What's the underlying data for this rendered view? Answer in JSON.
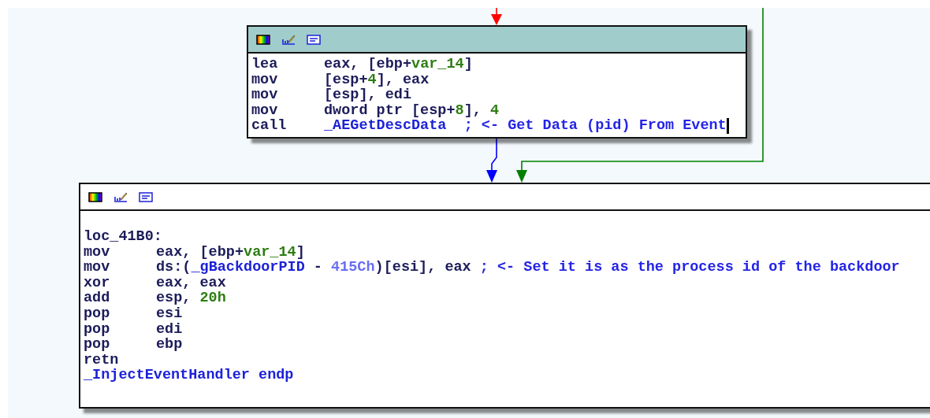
{
  "nodes": [
    {
      "selected": true,
      "lines": [
        {
          "kind": "instr",
          "cursor": false,
          "mnemonic": "lea",
          "operands": [
            {
              "kind": "text",
              "text": "eax, [ebp+"
            },
            {
              "kind": "var",
              "text": "var_14"
            },
            {
              "kind": "text",
              "text": "]"
            }
          ]
        },
        {
          "kind": "instr",
          "cursor": false,
          "mnemonic": "mov",
          "operands": [
            {
              "kind": "text",
              "text": "[esp+"
            },
            {
              "kind": "var",
              "text": "4"
            },
            {
              "kind": "text",
              "text": "], eax"
            }
          ]
        },
        {
          "kind": "instr",
          "cursor": false,
          "mnemonic": "mov",
          "operands": [
            {
              "kind": "text",
              "text": "[esp], edi"
            }
          ]
        },
        {
          "kind": "instr",
          "cursor": false,
          "mnemonic": "mov",
          "operands": [
            {
              "kind": "text",
              "text": "dword ptr [esp+"
            },
            {
              "kind": "var",
              "text": "8"
            },
            {
              "kind": "text",
              "text": "], "
            },
            {
              "kind": "var",
              "text": "4"
            }
          ]
        },
        {
          "kind": "instr",
          "cursor": true,
          "mnemonic": "call",
          "operands": [
            {
              "kind": "name",
              "text": "_AEGetDescData"
            },
            {
              "kind": "comment",
              "text": "  ; <- Get Data (pid) From Event"
            }
          ]
        }
      ]
    },
    {
      "selected": false,
      "lines": [
        {
          "kind": "label",
          "cursor": false,
          "text": "loc_41B0:"
        },
        {
          "kind": "instr",
          "cursor": false,
          "mnemonic": "mov",
          "operands": [
            {
              "kind": "text",
              "text": "eax, [ebp+"
            },
            {
              "kind": "var",
              "text": "var_14"
            },
            {
              "kind": "text",
              "text": "]"
            }
          ]
        },
        {
          "kind": "instr",
          "cursor": false,
          "mnemonic": "mov",
          "operands": [
            {
              "kind": "text",
              "text": "ds:("
            },
            {
              "kind": "name",
              "text": "_gBackdoorPID"
            },
            {
              "kind": "text",
              "text": " - "
            },
            {
              "kind": "offset",
              "text": "415Ch"
            },
            {
              "kind": "text",
              "text": ")[esi], eax"
            },
            {
              "kind": "comment",
              "text": " ; <- Set it is as the process id of the backdoor"
            }
          ]
        },
        {
          "kind": "instr",
          "cursor": false,
          "mnemonic": "xor",
          "operands": [
            {
              "kind": "text",
              "text": "eax, eax"
            }
          ]
        },
        {
          "kind": "instr",
          "cursor": false,
          "mnemonic": "add",
          "operands": [
            {
              "kind": "text",
              "text": "esp, "
            },
            {
              "kind": "var",
              "text": "20h"
            }
          ]
        },
        {
          "kind": "instr",
          "cursor": false,
          "mnemonic": "pop",
          "operands": [
            {
              "kind": "text",
              "text": "esi"
            }
          ]
        },
        {
          "kind": "instr",
          "cursor": false,
          "mnemonic": "pop",
          "operands": [
            {
              "kind": "text",
              "text": "edi"
            }
          ]
        },
        {
          "kind": "instr",
          "cursor": false,
          "mnemonic": "pop",
          "operands": [
            {
              "kind": "text",
              "text": "ebp"
            }
          ]
        },
        {
          "kind": "instr",
          "cursor": false,
          "mnemonic": "retn"
        },
        {
          "kind": "endp",
          "cursor": false,
          "text": "_InjectEventHandler",
          "suffix": "endp"
        }
      ]
    }
  ]
}
